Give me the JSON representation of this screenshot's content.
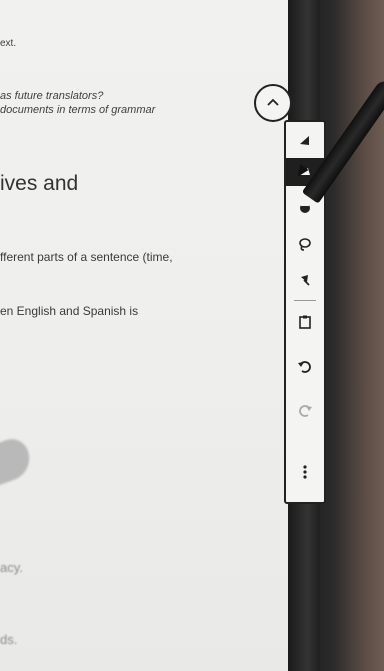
{
  "document": {
    "line1": "ext.",
    "line2": "as future translators?",
    "line3": "documents in terms of grammar",
    "heading": "ives and",
    "line4": "fferent parts of a sentence (time,",
    "line5": "en English and Spanish is",
    "line6": "acy.",
    "line7": "ds."
  },
  "toolbar": {
    "collapse_icon": "chevron-up-icon",
    "tools": [
      {
        "name": "pen-tool",
        "icon": "pen-icon",
        "active": false
      },
      {
        "name": "highlighter-tool",
        "icon": "highlighter-icon",
        "active": true
      },
      {
        "name": "eraser-tool",
        "icon": "eraser-icon",
        "active": false
      },
      {
        "name": "lasso-tool",
        "icon": "lasso-icon",
        "active": false
      },
      {
        "name": "pin-tool",
        "icon": "pin-icon",
        "active": false
      },
      {
        "name": "clipboard-tool",
        "icon": "clipboard-icon",
        "active": false
      },
      {
        "name": "undo-tool",
        "icon": "undo-icon",
        "active": false
      },
      {
        "name": "redo-tool",
        "icon": "redo-icon",
        "active": false
      },
      {
        "name": "more-tool",
        "icon": "more-icon",
        "active": false
      }
    ]
  },
  "colors": {
    "toolbar_border": "#222222",
    "toolbar_bg": "#f4f4f2",
    "screen_bg": "#efefed",
    "bezel": "#2b2b2b"
  }
}
